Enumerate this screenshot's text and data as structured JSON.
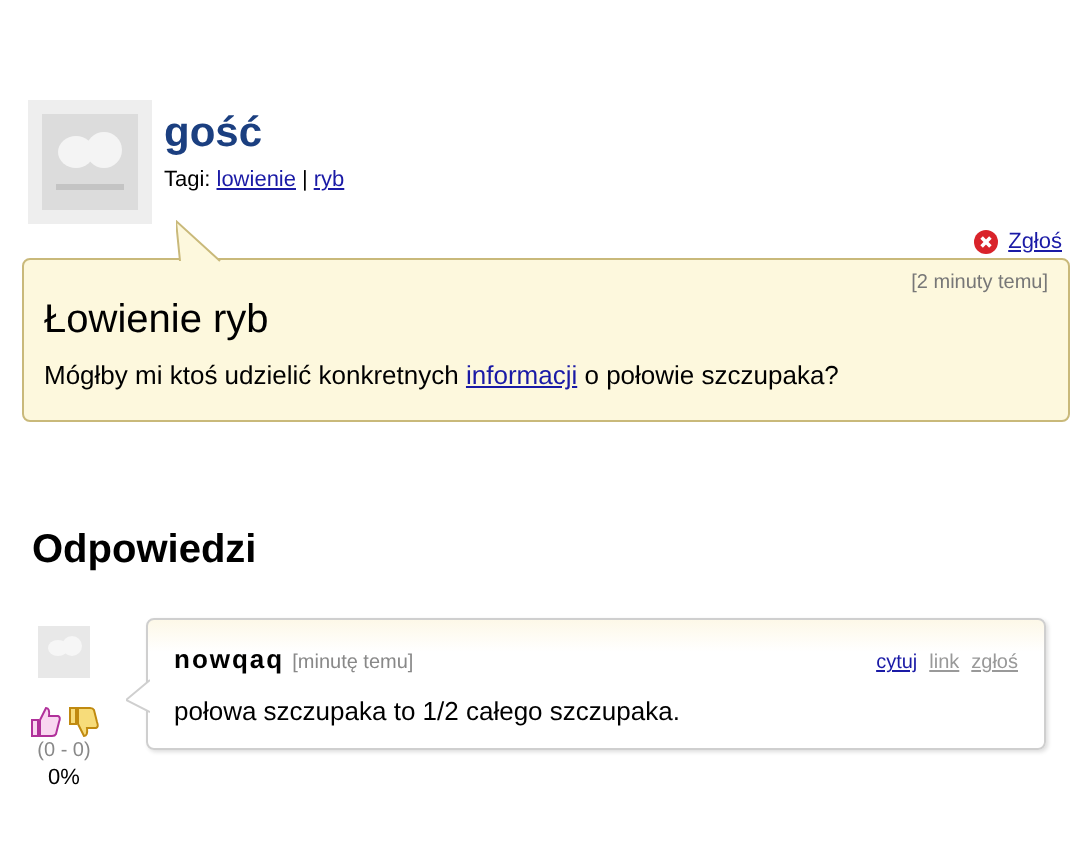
{
  "question": {
    "author": "gość",
    "tags_label": "Tagi:",
    "tags": [
      "lowienie",
      "ryb"
    ],
    "tag_separator": "|",
    "report": "Zgłoś",
    "time": "[2 minuty temu]",
    "title": "Łowienie ryb",
    "body_before": "Mógłby mi ktoś udzielić konkretnych",
    "body_link": "informacji",
    "body_after": "o połowie szczupaka?"
  },
  "answers_heading": "Odpowiedzi",
  "answers": [
    {
      "author": "nowqaq",
      "time": "[minutę temu]",
      "text": "połowa szczupaka to 1/2 całego szczupaka.",
      "votes": "(0 - 0)",
      "percent": "0%",
      "actions": [
        {
          "label": "cytuj",
          "muted": false
        },
        {
          "label": "link",
          "muted": true
        },
        {
          "label": "zgłoś",
          "muted": true
        }
      ]
    }
  ]
}
